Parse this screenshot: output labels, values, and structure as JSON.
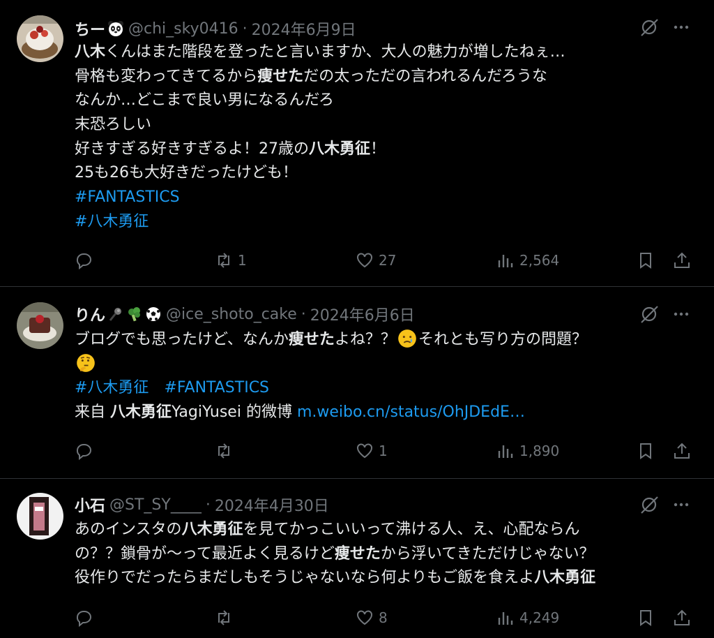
{
  "tweets": [
    {
      "name": "ちー",
      "name_emoji": "panda-emoji",
      "handle": "@chi_sky0416",
      "date": "2024年6月9日",
      "lines": [
        [
          {
            "t": "八木",
            "b": true
          },
          {
            "t": "くんはまた階段を登ったと言いますか、大人の魅力が増したねぇ…"
          }
        ],
        [
          {
            "t": "骨格も変わってきてるから"
          },
          {
            "t": "痩せた",
            "b": true
          },
          {
            "t": "だの太っただの言われるんだろうな"
          }
        ],
        [
          {
            "t": "なんか…どこまで良い男になるんだろ"
          }
        ],
        [
          {
            "t": "末恐ろしい"
          }
        ],
        [
          {
            "t": "好きすぎる好きすぎるよ！27歳の"
          },
          {
            "t": "八木勇征",
            "b": true
          },
          {
            "t": "！"
          }
        ],
        [
          {
            "t": "25も26も大好きだったけども！"
          }
        ],
        [
          {
            "t": "#FANTASTICS",
            "link": true
          }
        ],
        [
          {
            "t": "#八木勇征",
            "link": true
          }
        ]
      ],
      "reply_count": "",
      "repost_count": "1",
      "like_count": "27",
      "view_count": "2,564"
    },
    {
      "name": "りん",
      "name_emoji": "microphone-broccoli-soccer-emoji",
      "handle": "@ice_shoto_cake",
      "date": "2024年6月6日",
      "lines": [
        [
          {
            "t": "ブログでも思ったけど、なんか"
          },
          {
            "t": "痩せた",
            "b": true
          },
          {
            "t": "よね？？"
          },
          {
            "emoji": "sad-tear-face-emoji"
          },
          {
            "t": "それとも写り方の問題？"
          }
        ],
        [
          {
            "emoji": "thinking-face-emoji"
          }
        ],
        [
          {
            "t": "#八木勇征",
            "link": true
          },
          {
            "t": "　"
          },
          {
            "t": "#FANTASTICS",
            "link": true
          }
        ],
        [
          {
            "t": "来自 "
          },
          {
            "t": "八木勇征",
            "b": true
          },
          {
            "t": "YagiYusei 的微博 "
          },
          {
            "t": "m.weibo.cn/status/OhJDEdE…",
            "link": true
          }
        ]
      ],
      "reply_count": "",
      "repost_count": "",
      "like_count": "1",
      "view_count": "1,890"
    },
    {
      "name": "小石",
      "name_emoji": "",
      "handle": "@ST_SY____",
      "date": "2024年4月30日",
      "lines": [
        [
          {
            "t": "あのインスタの"
          },
          {
            "t": "八木勇征",
            "b": true
          },
          {
            "t": "を見てかっこいいって沸ける人、え、心配ならん"
          }
        ],
        [
          {
            "t": "の？？鎖骨が〜って最近よく見るけど"
          },
          {
            "t": "痩せた",
            "b": true
          },
          {
            "t": "から浮いてきただけじゃない？"
          }
        ],
        [
          {
            "t": "役作りでだったらまだしもそうじゃないなら何よりもご飯を食えよ"
          },
          {
            "t": "八木勇征",
            "b": true
          }
        ]
      ],
      "reply_count": "",
      "repost_count": "",
      "like_count": "8",
      "view_count": "4,249"
    }
  ],
  "icons": {
    "reply": "reply-icon",
    "repost": "repost-icon",
    "like": "like-icon",
    "views": "views-icon",
    "bookmark": "bookmark-icon",
    "share": "share-icon",
    "grok": "grok-icon",
    "more": "more-icon"
  },
  "colors": {
    "background": "#000000",
    "text": "#e7e9ea",
    "muted": "#71767b",
    "link": "#1d9bf0",
    "separator": "#2f3336"
  }
}
